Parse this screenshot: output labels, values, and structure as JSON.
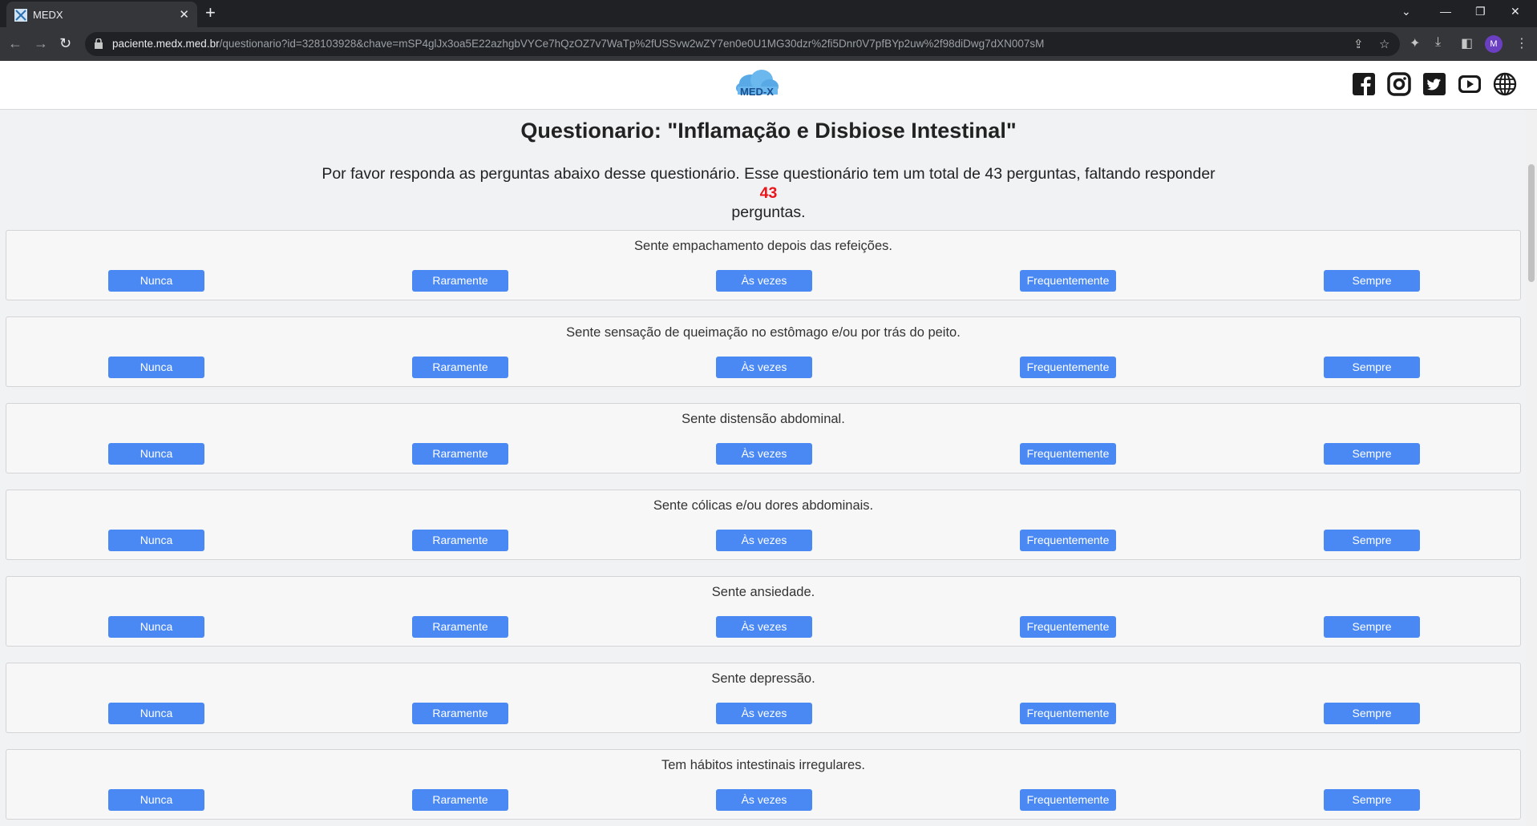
{
  "browser": {
    "tab_title": "MEDX",
    "tab_close": "✕",
    "new_tab": "+",
    "url_host": "paciente.medx.med.br",
    "url_path": "/questionario?id=328103928&chave=mSP4glJx3oa5E22azhgbVYCe7hQzOZ7v7WaTp%2fUSSvw2wZY7en0e0U1MG30dzr%2fi5Dnr0V7pfBYp2uw%2f98diDwg7dXN007sM",
    "profile_initial": "M"
  },
  "header": {
    "logo_text": "MED-X"
  },
  "page": {
    "title": "Questionario: \"Inflamação e Disbiose Intestinal\"",
    "intro_text": "Por favor responda as perguntas abaixo desse questionário. Esse questionário tem um total de 43 perguntas, faltando responder",
    "remaining_count": "43",
    "intro_suffix": "perguntas."
  },
  "options": [
    "Nunca",
    "Raramente",
    "Às vezes",
    "Frequentemente",
    "Sempre"
  ],
  "questions": [
    "Sente empachamento depois das refeições.",
    "Sente sensação de queimação no estômago e/ou por trás do peito.",
    "Sente distensão abdominal.",
    "Sente cólicas e/ou dores abdominais.",
    "Sente ansiedade.",
    "Sente depressão.",
    "Tem hábitos intestinais irregulares."
  ],
  "colors": {
    "button": "#4a89f3",
    "count": "#e8161b",
    "chrome_dark": "#202124",
    "chrome_toolbar": "#35363a"
  }
}
